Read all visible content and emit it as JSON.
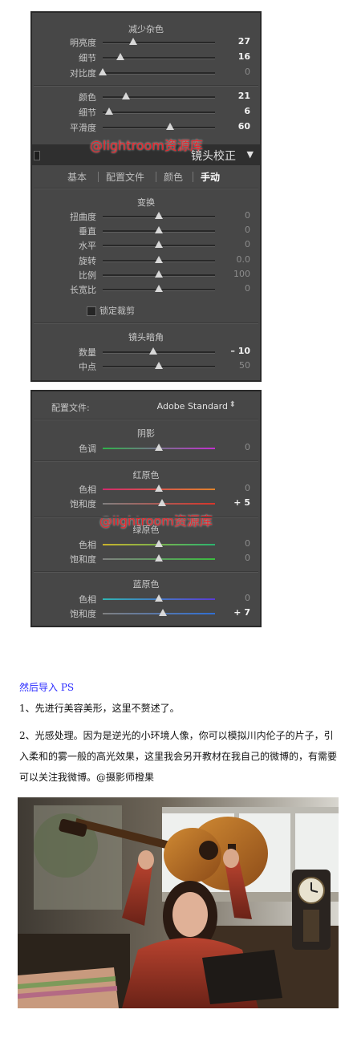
{
  "panel1": {
    "noise_section": {
      "title": "减少杂色",
      "rows": [
        {
          "label": "明亮度",
          "value": "27",
          "knob": 27,
          "bright": true
        },
        {
          "label": "细节",
          "value": "16",
          "knob": 16,
          "bright": true
        },
        {
          "label": "对比度",
          "value": "0",
          "knob": 0,
          "bright": false
        }
      ]
    },
    "color_rows": [
      {
        "label": "颜色",
        "value": "21",
        "knob": 21,
        "bright": true
      },
      {
        "label": "细节",
        "value": "6",
        "knob": 6,
        "bright": true
      },
      {
        "label": "平滑度",
        "value": "60",
        "knob": 60,
        "bright": true
      }
    ],
    "header": {
      "title": "镜头校正",
      "arrow": "▼"
    },
    "tabs": [
      {
        "label": "基本",
        "active": false
      },
      {
        "label": "配置文件",
        "active": false
      },
      {
        "label": "颜色",
        "active": false
      },
      {
        "label": "手动",
        "active": true
      }
    ],
    "transform": {
      "title": "变换",
      "rows": [
        {
          "label": "扭曲度",
          "value": "0",
          "knob": 50
        },
        {
          "label": "垂直",
          "value": "0",
          "knob": 50
        },
        {
          "label": "水平",
          "value": "0",
          "knob": 50
        },
        {
          "label": "旋转",
          "value": "0.0",
          "knob": 50
        },
        {
          "label": "比例",
          "value": "100",
          "knob": 50
        },
        {
          "label": "长宽比",
          "value": "0",
          "knob": 50
        }
      ],
      "lock_crop": "锁定裁剪"
    },
    "vignette": {
      "title": "镜头暗角",
      "rows": [
        {
          "label": "数量",
          "value": "– 10",
          "knob": 45,
          "bright": true
        },
        {
          "label": "中点",
          "value": "50",
          "knob": 50,
          "bright": false
        }
      ]
    }
  },
  "panel2": {
    "profile_label": "配置文件:",
    "profile_value": "Adobe Standard",
    "profile_arrow": "⬍",
    "shadows": {
      "title": "阴影",
      "rows": [
        {
          "label": "色调",
          "value": "0",
          "knob": 50,
          "bright": false
        }
      ]
    },
    "red": {
      "title": "红原色",
      "rows": [
        {
          "label": "色相",
          "value": "0",
          "knob": 50,
          "bright": false
        },
        {
          "label": "饱和度",
          "value": "+ 5",
          "knob": 52.5,
          "bright": true
        }
      ]
    },
    "green": {
      "title": "绿原色",
      "rows": [
        {
          "label": "色相",
          "value": "0",
          "knob": 50,
          "bright": false
        },
        {
          "label": "饱和度",
          "value": "0",
          "knob": 50,
          "bright": false
        }
      ]
    },
    "blue": {
      "title": "蓝原色",
      "rows": [
        {
          "label": "色相",
          "value": "0",
          "knob": 50,
          "bright": false
        },
        {
          "label": "饱和度",
          "value": "+ 7",
          "knob": 53.5,
          "bright": true
        }
      ]
    }
  },
  "watermark": "@lightroom资源库",
  "article": {
    "title": "然后导入 PS",
    "p1": "1、先进行美容美形，这里不赘述了。",
    "p2": "2、光感处理。因为是逆光的小环境人像，你可以模拟川内伦子的片子，引入柔和的雾一般的高光效果，这里我会另开教材在我自己的微博的，有需要可以关注我微博。@摄影师橙果"
  },
  "colors": {
    "panel_bg": "#474747",
    "watermark": "#e7262c",
    "title_blue": "#2a2aff"
  }
}
